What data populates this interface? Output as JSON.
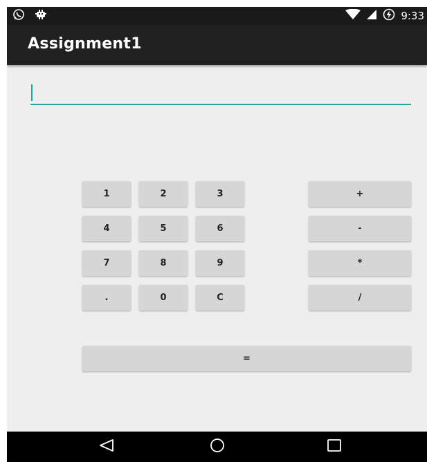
{
  "status_bar": {
    "time": "9:33",
    "left_icons": [
      "whatsapp-icon",
      "notification-bug-icon"
    ],
    "right_icons": [
      "wifi-icon",
      "signal-icon",
      "battery-charging-icon"
    ]
  },
  "app_bar": {
    "title": "Assignment1"
  },
  "input": {
    "value": "",
    "placeholder": ""
  },
  "keypad": {
    "digits": {
      "row1": [
        "1",
        "2",
        "3"
      ],
      "row2": [
        "4",
        "5",
        "6"
      ],
      "row3": [
        "7",
        "8",
        "9"
      ],
      "row4": [
        ".",
        "0",
        "C"
      ]
    },
    "operators": [
      "+",
      "-",
      "*",
      "/"
    ],
    "equals": "="
  },
  "nav_bar": {
    "buttons": [
      "back-icon",
      "home-icon",
      "recents-icon"
    ]
  },
  "colors": {
    "accent": "#26a69a",
    "app_bar": "#212121",
    "status_bar": "#1a1a1a",
    "background": "#eeeeee",
    "key": "#d6d6d6"
  }
}
